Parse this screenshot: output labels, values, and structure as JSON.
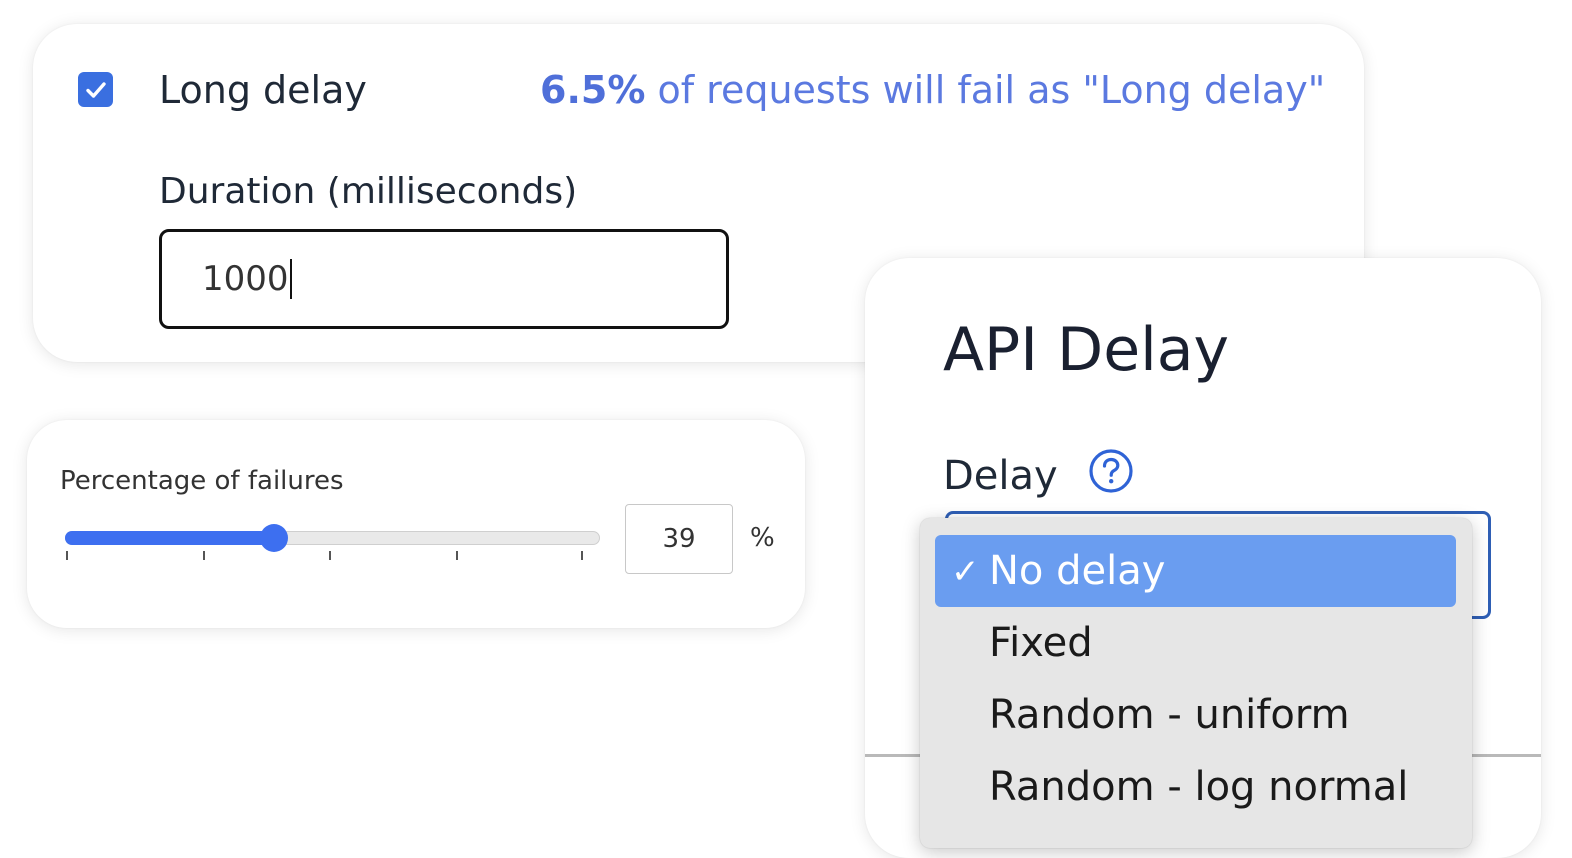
{
  "long_delay": {
    "checkbox_checked": true,
    "label": "Long delay",
    "fail_percent": "6.5%",
    "fail_message": " of requests will fail as \"Long delay\"",
    "duration_label": "Duration (milliseconds)",
    "duration_value": "1000"
  },
  "failures": {
    "label": "Percentage of failures",
    "slider_value_percent": 39,
    "input_value": "39",
    "unit": "%"
  },
  "api_delay": {
    "title": "API Delay",
    "delay_label": "Delay",
    "help_icon": "question-circle-icon",
    "options": [
      {
        "label": "No delay",
        "selected": true,
        "check": "✓"
      },
      {
        "label": "Fixed",
        "selected": false
      },
      {
        "label": "Random - uniform",
        "selected": false
      },
      {
        "label": "Random - log normal",
        "selected": false
      }
    ]
  },
  "colors": {
    "accent": "#3d6ff0",
    "checkbox": "#3a6fe0",
    "fail_text": "#5b79e0",
    "select_border": "#2f5fb5",
    "option_highlight": "#6a9df0",
    "dropdown_bg": "#e6e6e6"
  }
}
